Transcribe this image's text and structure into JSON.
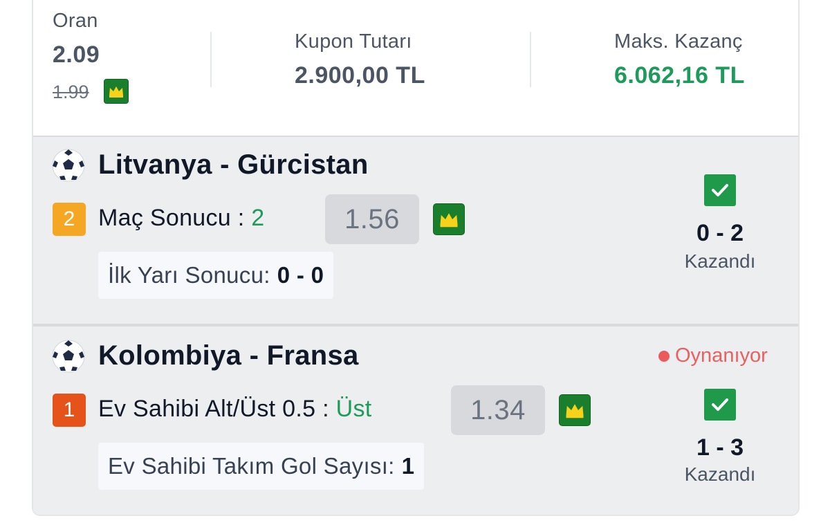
{
  "summary": {
    "odds_label": "Oran",
    "odds_value": "2.09",
    "old_odds": "1.99",
    "stake_label": "Kupon Tutarı",
    "stake_value": "2.900,00 TL",
    "max_win_label": "Maks. Kazanç",
    "max_win_value": "6.062,16 TL"
  },
  "matches": [
    {
      "title": "Litvanya - Gürcistan",
      "badge": "2",
      "market_label": "Maç Sonucu :",
      "pick": "2",
      "odd": "1.56",
      "info_label": "İlk Yarı Sonucu:",
      "info_value": "0 - 0",
      "status": "",
      "score": "0 - 2",
      "result": "Kazandı"
    },
    {
      "title": "Kolombiya - Fransa",
      "badge": "1",
      "market_label": "Ev Sahibi Alt/Üst 0.5 :",
      "pick": "Üst",
      "odd": "1.34",
      "info_label": "Ev Sahibi Takım Gol Sayısı:",
      "info_value": "1",
      "status": "Oynanıyor",
      "score": "1 - 3",
      "result": "Kazandı"
    }
  ],
  "colors": {
    "win_green": "#1e9a5a",
    "crown_green": "#1a7f2c",
    "badge_orange": "#f5a623",
    "badge_red": "#e5531a",
    "live_red": "#e86060"
  },
  "icons": [
    "crown-icon",
    "soccer-ball-icon",
    "check-icon",
    "live-dot-icon"
  ]
}
